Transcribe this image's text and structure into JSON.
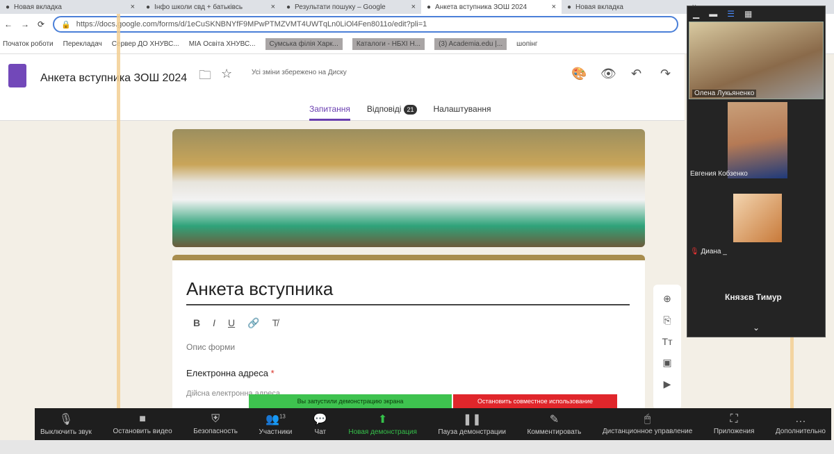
{
  "browser": {
    "tabs": [
      {
        "title": "Новая вкладка",
        "icon": "chrome-icon"
      },
      {
        "title": "Інфо школи свд + батьківсь",
        "icon": "gmail-icon"
      },
      {
        "title": "Результати пошуку – Google",
        "icon": "drive-icon"
      },
      {
        "title": "Анкета вступника ЗОШ 2024",
        "icon": "forms-icon",
        "active": true
      },
      {
        "title": "Новая вкладка",
        "icon": "chrome-icon"
      }
    ],
    "url": "https://docs.google.com/forms/d/1eCuSKNBNYfF9MPwPTMZVMT4UWTqLn0LiOl4Fen8011o/edit?pli=1",
    "bookmarks": [
      "Початок роботи",
      "Перекладач",
      "Сервер ДО ХНУВС...",
      "МІА Освіта ХНУВС...",
      "Сумська філія Харк...",
      "Каталоги - НБХІ Н...",
      "(3) Academia.edu |...",
      "шопінг"
    ]
  },
  "form": {
    "title": "Анкета вступника ЗОШ 2024",
    "saved": "Усі зміни збережено на Диску",
    "tabs": [
      "Запитання",
      "Відповіді",
      "Налаштування"
    ],
    "responses": "21",
    "heading": "Анкета вступника",
    "format": [
      "B",
      "I",
      "U",
      "🔗",
      "T̸"
    ],
    "description_placeholder": "Опис форми",
    "question": "Електронна адреса",
    "required": "*",
    "answer_placeholder": "Дійсна електронна адреса"
  },
  "zoom": {
    "participants": [
      {
        "name": "Олена Лукьяненко"
      },
      {
        "name": "Евгения Кобзенко"
      },
      {
        "name": "Диана _"
      },
      {
        "name": "Князєв Тимур"
      }
    ],
    "share_notice": "Вы запустили демонстрацию экрана",
    "stop_share": "Остановить совместное использование",
    "toolbar": [
      {
        "label": "Выключить звук",
        "icon": "microphone-icon",
        "glyph": "🎙"
      },
      {
        "label": "Остановить видео",
        "icon": "video-icon",
        "glyph": "■"
      },
      {
        "label": "Безопасность",
        "icon": "shield-icon",
        "glyph": "⛨"
      },
      {
        "label": "Участники",
        "icon": "participants-icon",
        "glyph": "👥",
        "count": "13"
      },
      {
        "label": "Чат",
        "icon": "chat-icon",
        "glyph": "💬"
      },
      {
        "label": "Новая демонстрация",
        "icon": "share-screen-icon",
        "glyph": "⬆",
        "accent": true
      },
      {
        "label": "Пауза демонстрации",
        "icon": "pause-icon",
        "glyph": "❚❚"
      },
      {
        "label": "Комментировать",
        "icon": "pen-icon",
        "glyph": "✎"
      },
      {
        "label": "Дистанционное управление",
        "icon": "mouse-icon",
        "glyph": "🖱"
      },
      {
        "label": "Приложения",
        "icon": "apps-icon",
        "glyph": "⛶"
      },
      {
        "label": "Дополнительно",
        "icon": "more-icon",
        "glyph": "…"
      }
    ]
  },
  "colors": {
    "forms_purple": "#6a3fb0",
    "zoom_green": "#35c14a",
    "stop_red": "#e0262b"
  }
}
